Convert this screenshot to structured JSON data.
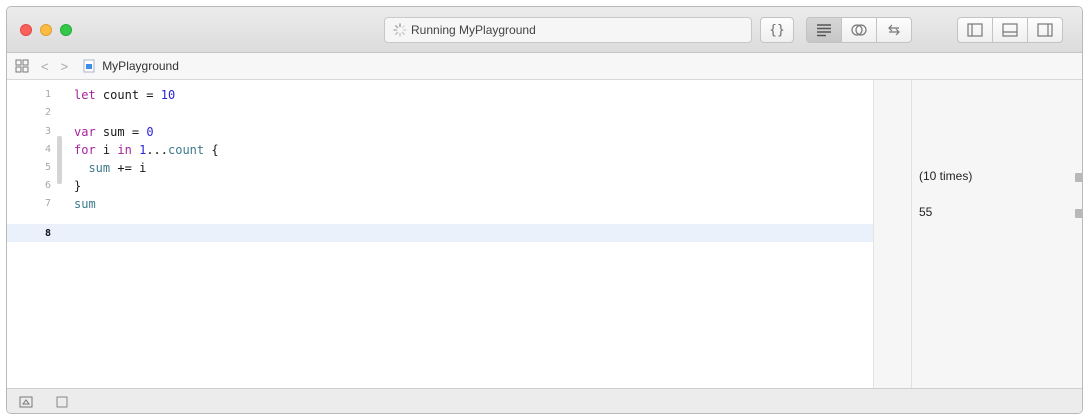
{
  "toolbar": {
    "status_text": "Running MyPlayground",
    "editor_braces": "{}",
    "icons": [
      "spinner-icon",
      "braces-icon",
      "standard-editor-icon",
      "assistant-editor-icon",
      "version-editor-icon",
      "navigator-panel-icon",
      "debug-panel-icon",
      "utilities-panel-icon"
    ]
  },
  "jumpbar": {
    "back_arrow": "<",
    "forward_arrow": ">",
    "file_name": "MyPlayground"
  },
  "editor": {
    "lines": [
      {
        "number": "1",
        "code": "let count = 10"
      },
      {
        "number": "2",
        "code": ""
      },
      {
        "number": "3",
        "code": "var sum = 0"
      },
      {
        "number": "4",
        "code": "for i in 1...count {"
      },
      {
        "number": "5",
        "code": "  sum += i"
      },
      {
        "number": "6",
        "code": "}"
      },
      {
        "number": "7",
        "code": "sum"
      },
      {
        "number": "8",
        "code": ""
      }
    ],
    "current_line": 8
  },
  "results": [
    {
      "line": 5,
      "value": "(10 times)"
    },
    {
      "line": 7,
      "value": "55"
    }
  ],
  "colors": {
    "keyword": "#a8239c",
    "number": "#2a24d8",
    "identifier": "#3d7a8c",
    "current_line_highlight": "#eaf1fb"
  }
}
